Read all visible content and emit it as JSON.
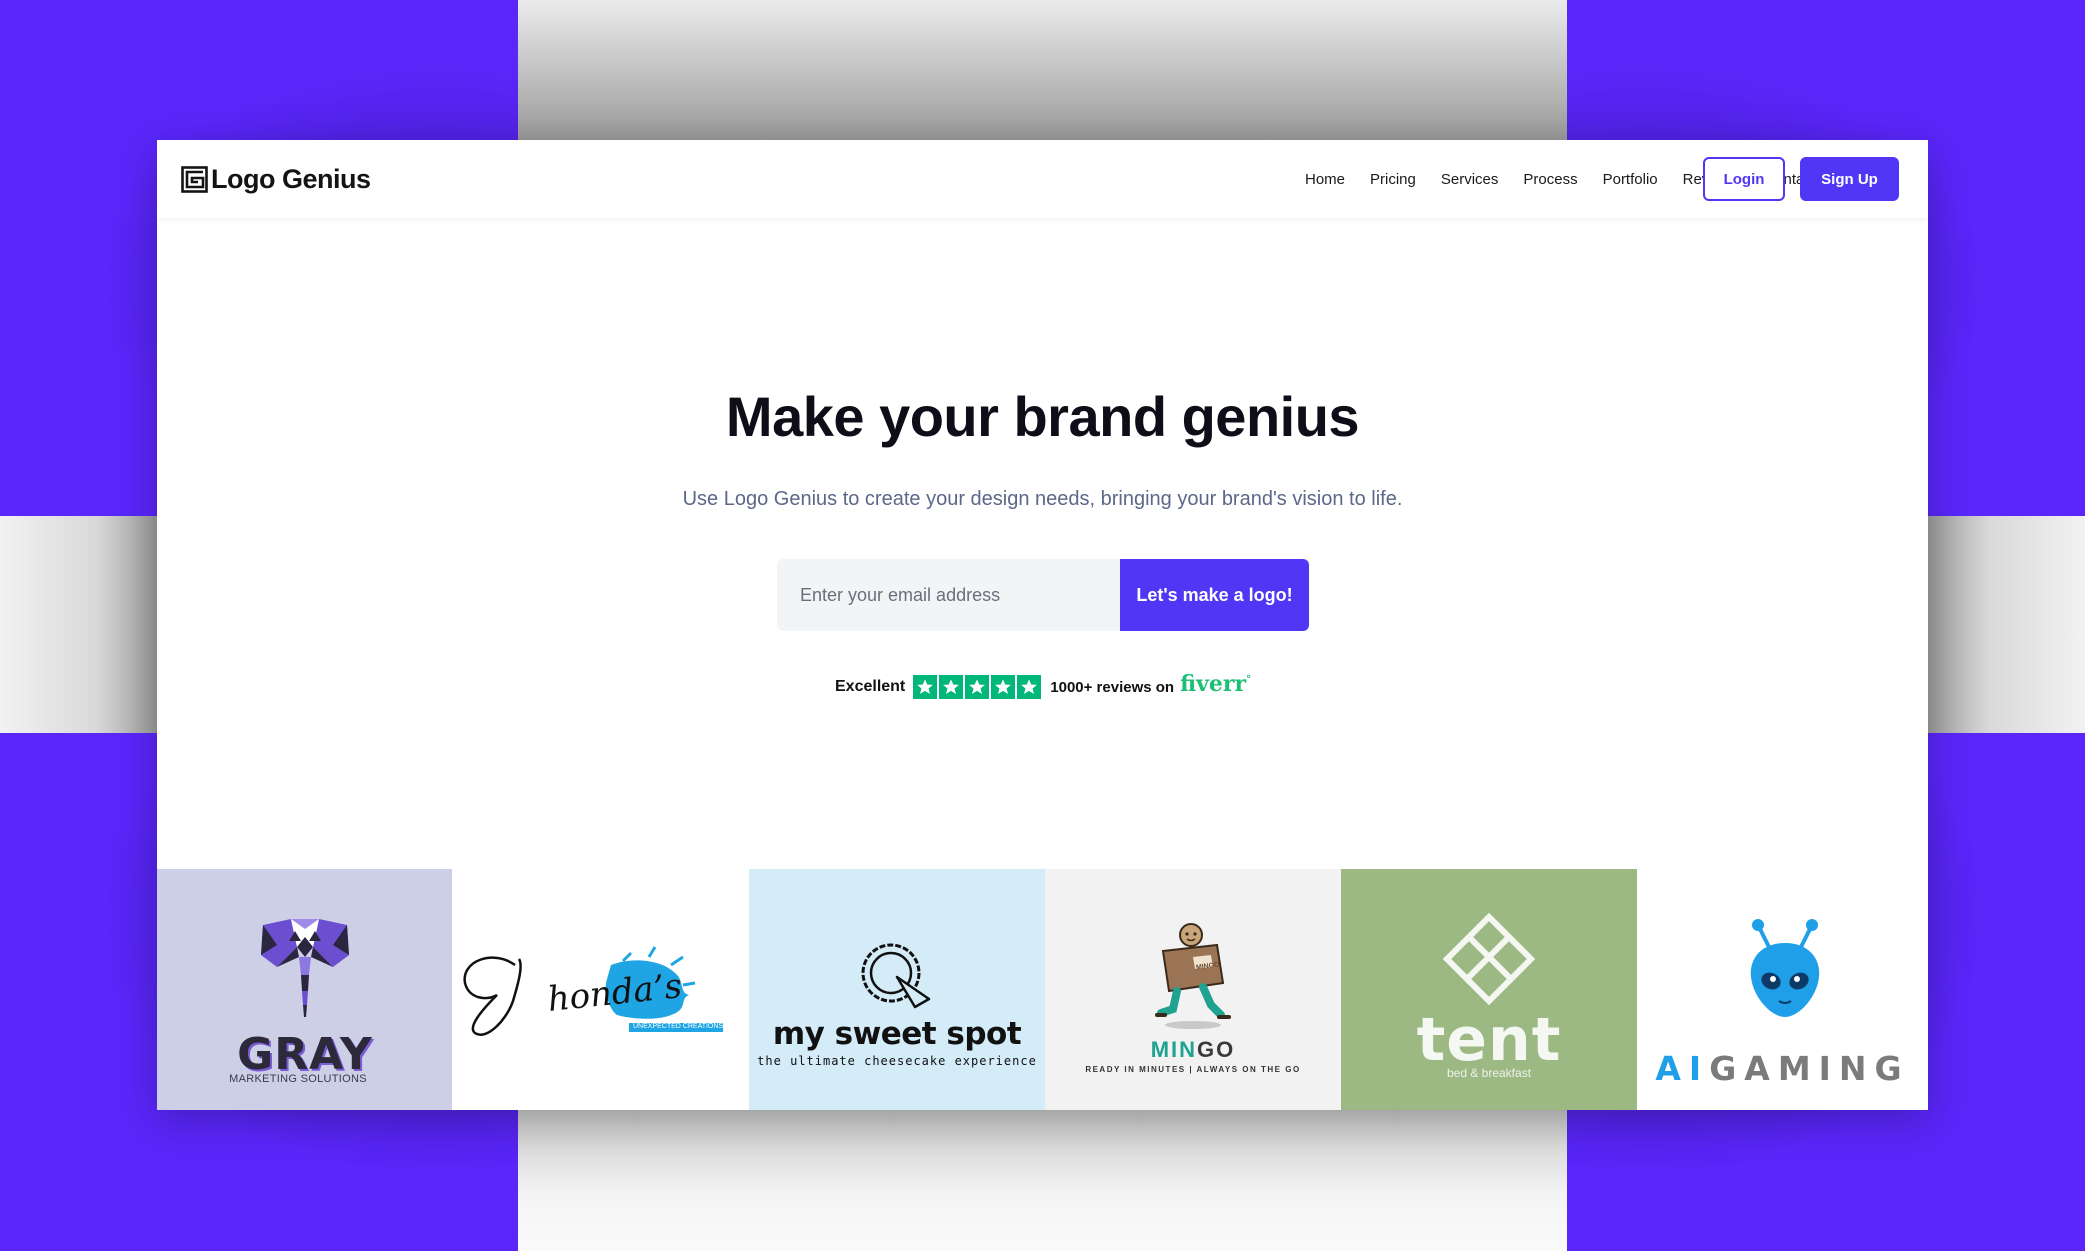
{
  "brand": {
    "name": "Logo Genius"
  },
  "nav": {
    "links": [
      "Home",
      "Pricing",
      "Services",
      "Process",
      "Portfolio",
      "Reviews",
      "Contact"
    ],
    "login_label": "Login",
    "signup_label": "Sign Up"
  },
  "hero": {
    "title": "Make your brand genius",
    "subtitle": "Use Logo Genius to create your design needs, bringing your brand's vision to life.",
    "email_placeholder": "Enter your email address",
    "cta_label": "Let's make a logo!"
  },
  "rating": {
    "label": "Excellent",
    "stars": 5,
    "reviews_text": "1000+ reviews on",
    "platform": "fiverr",
    "platform_mark": "°"
  },
  "portfolio": {
    "gray": {
      "name": "GRAY",
      "tagline": "MARKETING SOLUTIONS"
    },
    "shonda": {
      "name": "Shonda's",
      "tagline": "UNEXPECTED CREATIONS"
    },
    "sweet_spot": {
      "name": "my sweet spot",
      "tagline": "the ultimate cheesecake experience"
    },
    "mingo": {
      "name_a": "MIN",
      "name_b": "GO",
      "tagline": "READY IN MINUTES | ALWAYS ON THE GO",
      "box_text": "MINGO"
    },
    "tent": {
      "name": "tent",
      "tagline": "bed & breakfast"
    },
    "aigaming": {
      "name_a": "AI",
      "name_b": "GAMING"
    }
  },
  "colors": {
    "accent": "#5136f5",
    "background_purple": "#5a26fb",
    "trustpilot_green": "#00b67a",
    "fiverr_green": "#1dbf73"
  }
}
